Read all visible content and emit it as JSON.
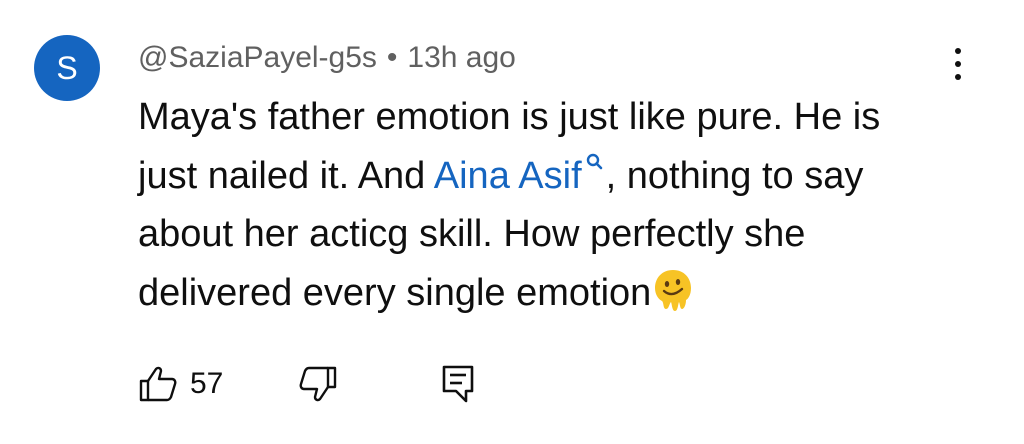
{
  "author": {
    "avatar_letter": "S",
    "avatar_color": "#1565c0",
    "handle": "@SaziaPayel-g5s",
    "separator": "•",
    "time_ago": "13h ago"
  },
  "comment": {
    "part1": "Maya's father emotion is just like pure. He is just nailed it. And ",
    "mention": "Aina Asif",
    "part2": ", nothing to say about her acticg skill. How perfectly she delivered every single emotion",
    "mention_color": "#1565c0",
    "emoji": "melting-face-emoji"
  },
  "actions": {
    "like_count": "57",
    "like_icon": "thumbs-up-icon",
    "dislike_icon": "thumbs-down-icon",
    "reply_icon": "reply-comment-icon"
  },
  "menu_icon": "more-vertical-icon"
}
